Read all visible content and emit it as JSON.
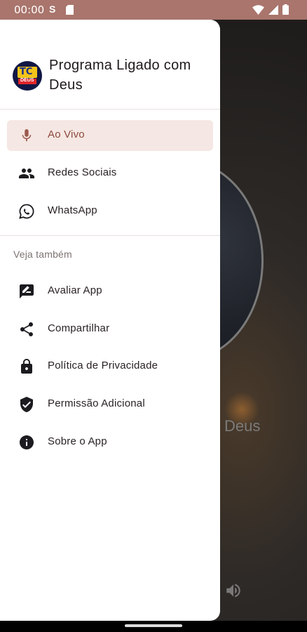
{
  "status_bar": {
    "time": "00:00",
    "carrier_icon": "S",
    "icons": [
      "sd-card-icon",
      "wifi-icon",
      "signal-icon",
      "battery-icon"
    ]
  },
  "drawer": {
    "app_title": "Programa Ligado com Deus",
    "logo": {
      "top_text": "TC",
      "bottom_text": "DEUS"
    },
    "primary_items": [
      {
        "label": "Ao Vivo",
        "icon": "microphone-icon",
        "active": true
      },
      {
        "label": "Redes Sociais",
        "icon": "people-icon",
        "active": false
      },
      {
        "label": "WhatsApp",
        "icon": "whatsapp-icon",
        "active": false
      }
    ],
    "section_title": "Veja também",
    "secondary_items": [
      {
        "label": "Avaliar App",
        "icon": "rate-review-icon"
      },
      {
        "label": "Compartilhar",
        "icon": "share-icon"
      },
      {
        "label": "Política de Privacidade",
        "icon": "lock-icon"
      },
      {
        "label": "Permissão Adicional",
        "icon": "shield-check-icon"
      },
      {
        "label": "Sobre o App",
        "icon": "info-icon"
      }
    ]
  },
  "background": {
    "title_fragment": "Deus"
  },
  "colors": {
    "status_bar": "#a9756c",
    "active_item_bg": "#f5e7e3",
    "active_item_text": "#8c4a3d"
  }
}
